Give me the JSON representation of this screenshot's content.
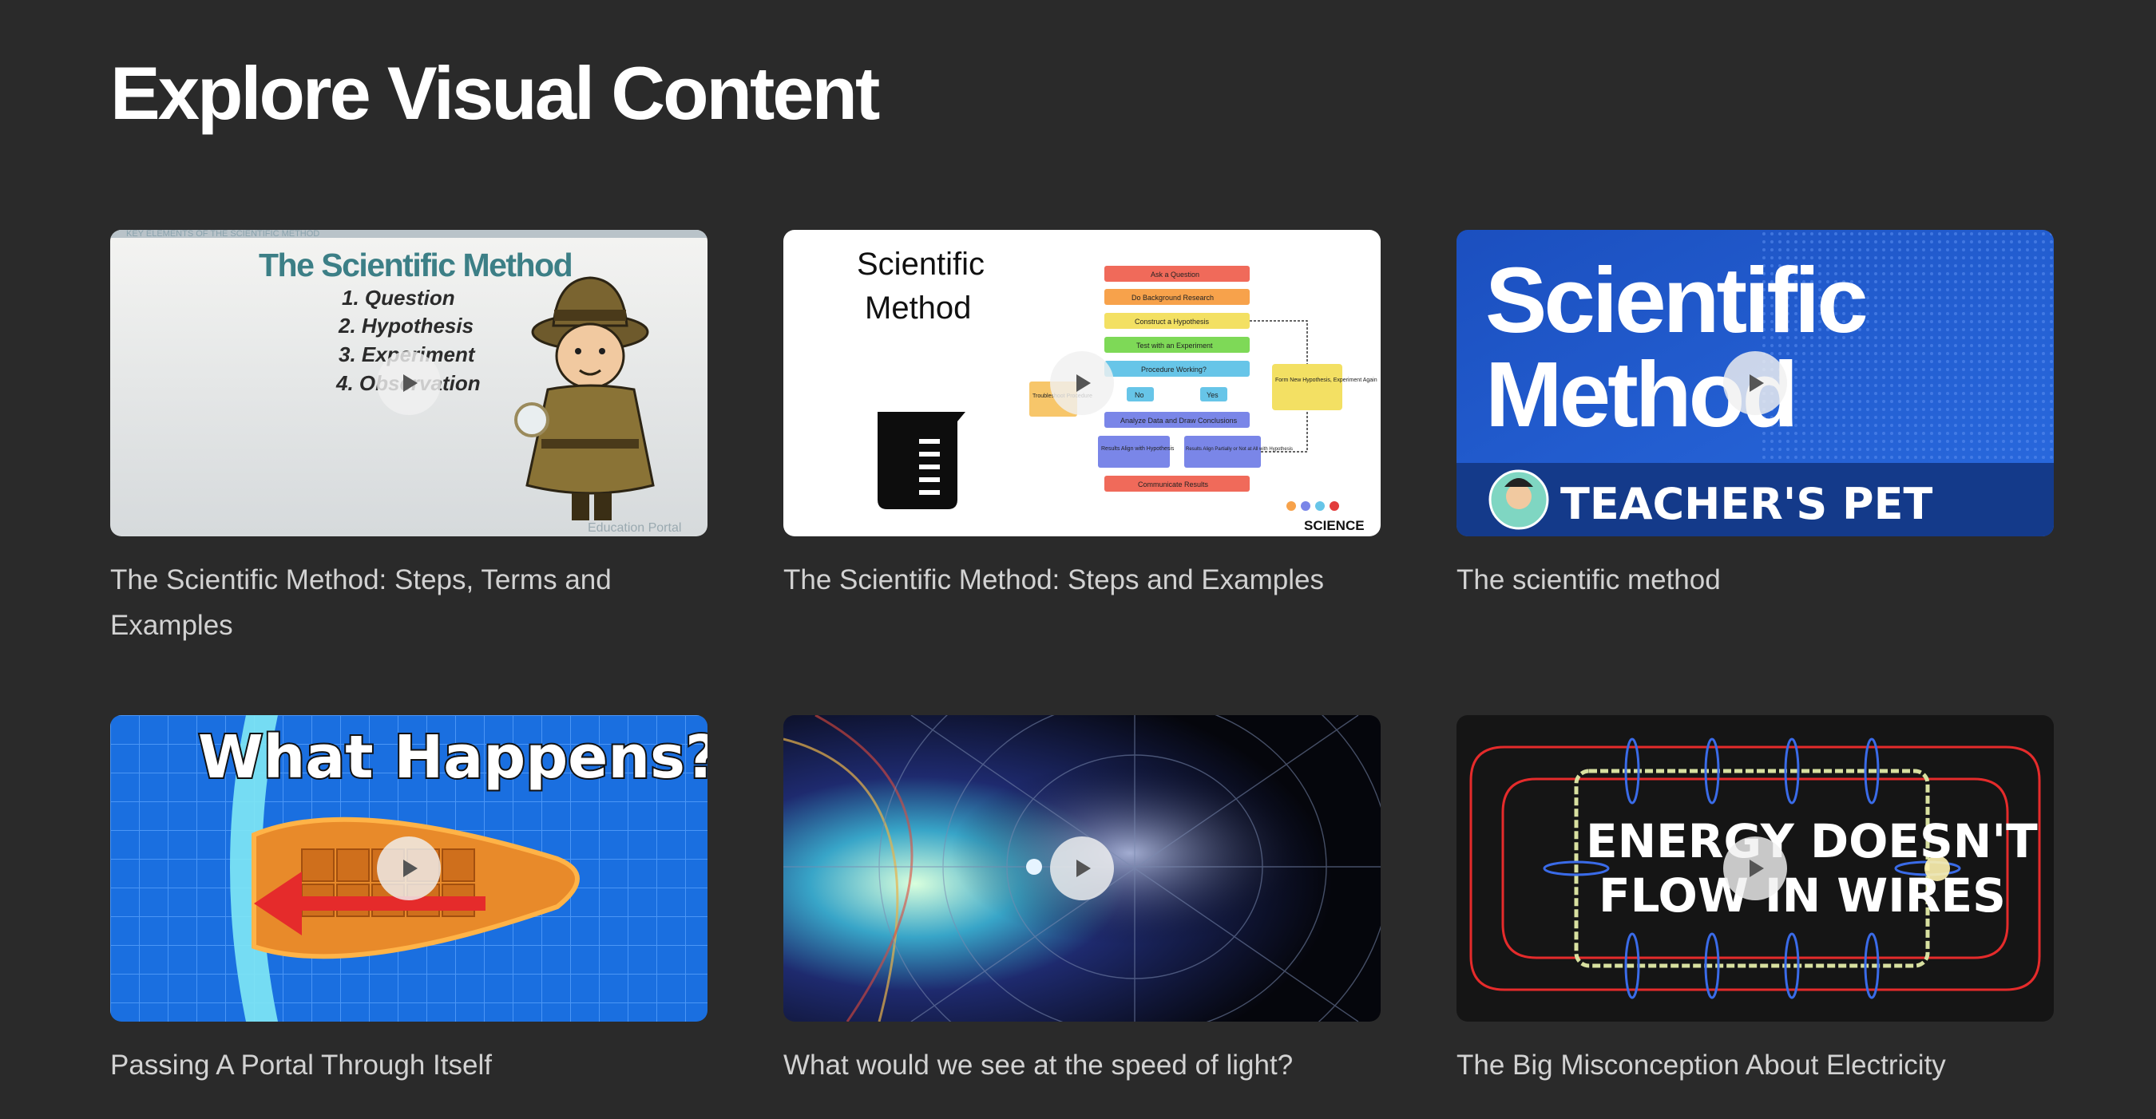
{
  "page": {
    "title": "Explore Visual Content"
  },
  "videos": [
    {
      "title": "The Scientific Method: Steps, Terms and Examples",
      "thumb": {
        "header": "KEY ELEMENTS OF THE SCIENTIFIC METHOD",
        "heading": "The Scientific Method",
        "steps": [
          "1. Question",
          "2. Hypothesis",
          "3. Experiment",
          "4. Observation"
        ],
        "brand": "Education Portal"
      }
    },
    {
      "title": "The Scientific Method: Steps and Examples",
      "thumb": {
        "heading_line1": "Scientific",
        "heading_line2": "Method",
        "flow_steps": [
          "Ask a Question",
          "Do Background Research",
          "Construct a Hypothesis",
          "Test with an Experiment",
          "Procedure Working?",
          "Analyze Data and Draw Conclusions",
          "Communicate Results"
        ],
        "branch_no": "No",
        "branch_yes": "Yes",
        "troubleshoot": "Troubleshoot Procedure",
        "align_yes": "Results Align with Hypothesis",
        "align_partial": "Results Align Partially or Not at All with Hypothesis",
        "new_hypothesis": "Form New Hypothesis, Experiment Again",
        "brand": "SCIENCE"
      }
    },
    {
      "title": "The scientific method",
      "thumb": {
        "line1": "Scientific",
        "line2": "Method",
        "banner": "TEACHER'S PET"
      }
    },
    {
      "title": "Passing A Portal Through Itself",
      "thumb": {
        "headline": "What Happens?"
      }
    },
    {
      "title": "What would we see at the speed of light?",
      "thumb": {}
    },
    {
      "title": "The Big Misconception About Electricity",
      "thumb": {
        "line1": "ENERGY DOESN'T",
        "line2": "FLOW IN WIRES"
      }
    }
  ]
}
